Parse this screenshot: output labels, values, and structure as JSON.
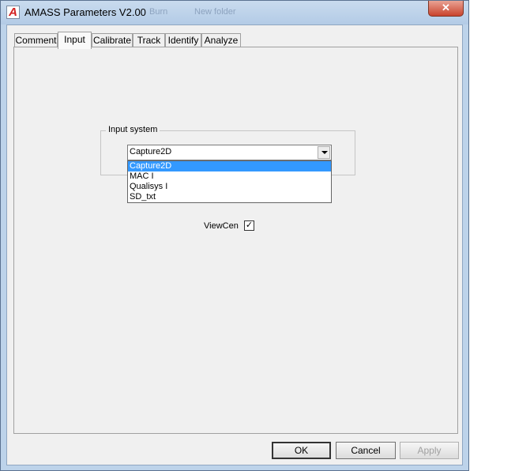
{
  "window": {
    "title": "AMASS Parameters V2.00",
    "app_icon_letter": "A",
    "background_text": [
      "Burn",
      "New folder"
    ],
    "close_symbol": "✕"
  },
  "tabs": [
    {
      "label": "Comment",
      "active": false
    },
    {
      "label": "Input",
      "active": true
    },
    {
      "label": "Calibrate",
      "active": false
    },
    {
      "label": "Track",
      "active": false
    },
    {
      "label": "Identify",
      "active": false
    },
    {
      "label": "Analyze",
      "active": false
    }
  ],
  "input_tab": {
    "group_label": "Input system",
    "selected": "Capture2D",
    "options": [
      "Capture2D",
      "MAC I",
      "Qualisys I",
      "SD_txt"
    ],
    "viewcen_label": "ViewCen",
    "viewcen_checked": true,
    "check_mark": "✓"
  },
  "buttons": {
    "ok": "OK",
    "cancel": "Cancel",
    "apply": "Apply"
  },
  "colors": {
    "selection": "#3399ff",
    "close_button": "#c9432d"
  }
}
